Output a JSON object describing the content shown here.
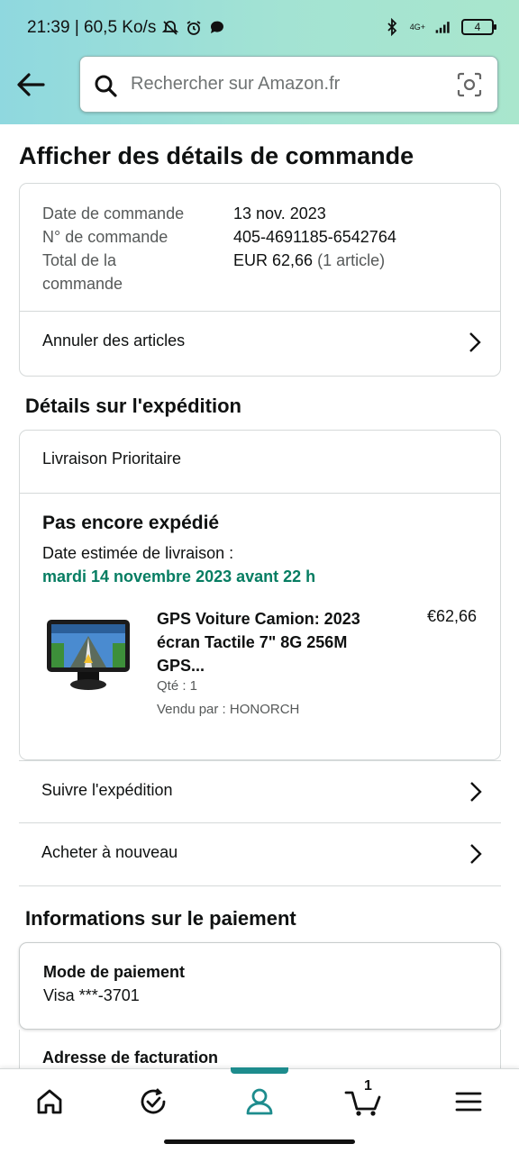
{
  "status_bar": {
    "time_speed": "21:39 | 60,5 Ko/s",
    "network": "4G+",
    "battery": "4"
  },
  "header": {
    "search_placeholder": "Rechercher sur Amazon.fr"
  },
  "page": {
    "title": "Afficher des détails de commande"
  },
  "order": {
    "date_label": "Date de commande",
    "date_value": "13 nov. 2023",
    "number_label": "N° de commande",
    "number_value": "405-4691185-6542764",
    "total_label_1": "Total de la",
    "total_label_2": "commande",
    "total_value": "EUR 62,66",
    "total_items": "(1 article)",
    "cancel_link": "Annuler des articles"
  },
  "shipping": {
    "section_title": "Détails sur l'expédition",
    "method": "Livraison Prioritaire",
    "status": "Pas encore expédié",
    "estimate_label": "Date estimée de livraison :",
    "estimate_date": "mardi 14 novembre 2023 avant 22 h",
    "product": {
      "title": "GPS Voiture Camion: 2023 écran Tactile 7\" 8G 256M GPS...",
      "price": "€62,66",
      "qty": "Qté : 1",
      "seller": "Vendu par : HONORCH"
    },
    "track_link": "Suivre l'expédition",
    "buy_again_link": "Acheter à nouveau"
  },
  "payment": {
    "section_title": "Informations sur le paiement",
    "method_label": "Mode de paiement",
    "method_value": "Visa  ***-3701",
    "billing_label": "Adresse de facturation"
  },
  "bottom_nav": {
    "cart_count": "1",
    "items": [
      "home-icon",
      "orders-icon",
      "account-icon",
      "cart-icon",
      "menu-icon"
    ],
    "active": "account-icon",
    "accent": "#1d8c8d"
  },
  "colors": {
    "delivery_green": "#067d62",
    "header_gradient_start": "#8fd8df",
    "header_gradient_end": "#a9e6cd"
  }
}
